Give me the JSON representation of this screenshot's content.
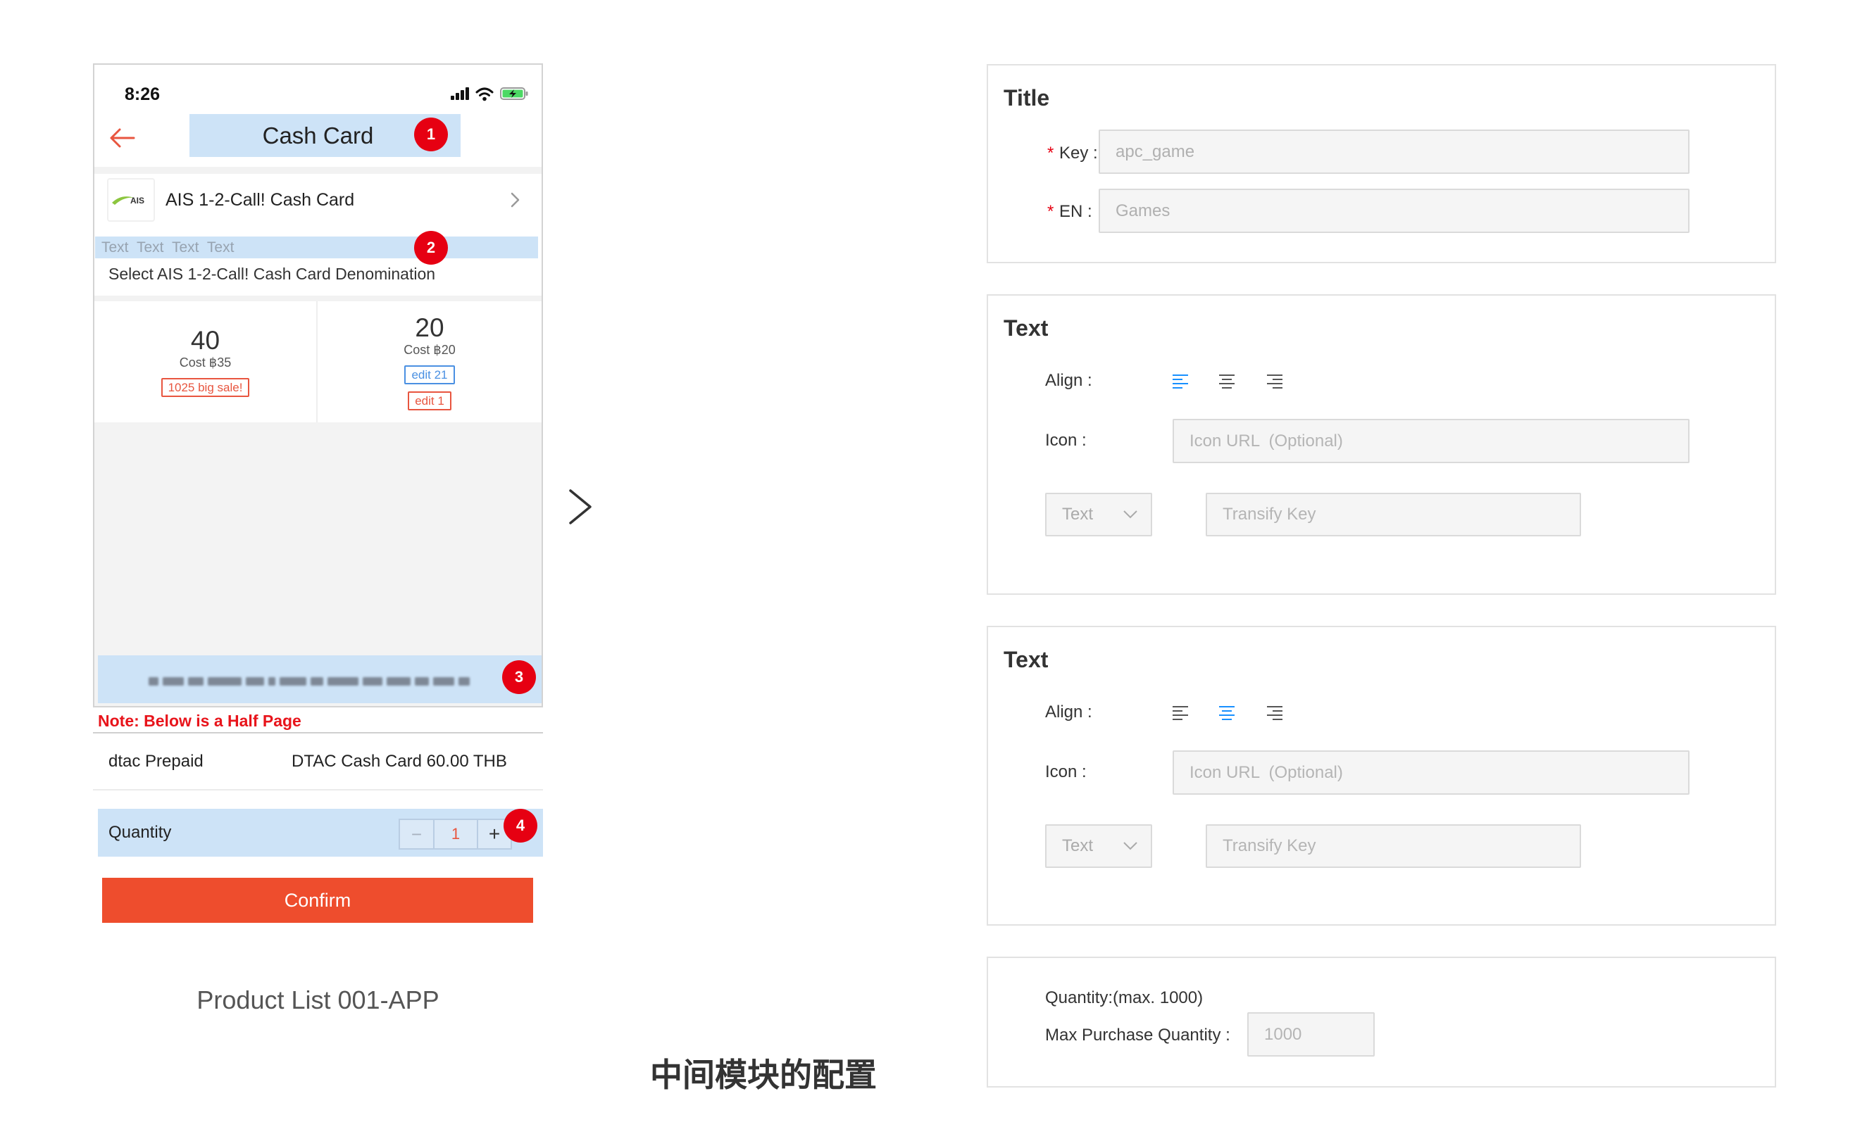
{
  "colors": {
    "badge_red": "#e60012",
    "note_red": "#e8141b",
    "back_arrow": "#e8553f",
    "confirm_orange": "#ee4d2d",
    "highlight_blue": "#cde3f7",
    "active_blue": "#1890ff",
    "tag_red": "#e8553f",
    "tag_blue": "#4a90e2",
    "battery_green": "#4cd964",
    "logo_green": "#8cc63f"
  },
  "phone": {
    "status_bar": {
      "time": "8:26",
      "icons": [
        "signal-icon",
        "wifi-icon",
        "battery-charging-icon"
      ]
    },
    "header": {
      "back_icon": "back-arrow-icon",
      "title": "Cash Card",
      "marker": "1"
    },
    "product": {
      "logo_text": "AIS",
      "name": "AIS 1-2-Call! Cash Card",
      "chevron_icon": "chevron-right-icon"
    },
    "text_strip": {
      "text": "Text Text Text Text",
      "marker": "2"
    },
    "denomination_prompt": "Select AIS 1-2-Call! Cash Card Denomination",
    "denominations": [
      {
        "value": "40",
        "cost": "Cost ฿35",
        "tags": [
          {
            "text": "1025 big sale!",
            "color": "#e8553f"
          }
        ]
      },
      {
        "value": "20",
        "cost": "Cost ฿20",
        "tags": [
          {
            "text": "edit 21",
            "color": "#4a90e2"
          },
          {
            "text": "edit 1",
            "color": "#e8553f"
          }
        ]
      }
    ],
    "blurred_strip": {
      "marker": "3"
    },
    "note": "Note: Below is a Half Page",
    "half_page": {
      "carrier": "dtac Prepaid",
      "product": "DTAC Cash Card 60.00 THB",
      "quantity_label": "Quantity",
      "quantity_minus": "−",
      "quantity_value": "1",
      "quantity_plus": "+",
      "marker": "4",
      "confirm_label": "Confirm"
    },
    "caption": "Product List 001-APP"
  },
  "transition_icon": "chevron-right-icon",
  "section_caption": "中间模块的配置",
  "config": {
    "title_panel": {
      "heading": "Title",
      "key_field": {
        "required_mark": "*",
        "label": "Key :",
        "value": "apc_game"
      },
      "en_field": {
        "required_mark": "*",
        "label": "EN :",
        "value": "Games"
      }
    },
    "text_panels": [
      {
        "heading": "Text",
        "align_label": "Align :",
        "align_options": [
          "align-left-icon",
          "align-center-icon",
          "align-right-icon"
        ],
        "align_active": 0,
        "icon_label": "Icon :",
        "icon_placeholder": "Icon URL  (Optional)",
        "type_select": "Text",
        "key_placeholder": "Transify Key"
      },
      {
        "heading": "Text",
        "align_label": "Align :",
        "align_options": [
          "align-left-icon",
          "align-center-icon",
          "align-right-icon"
        ],
        "align_active": 1,
        "icon_label": "Icon :",
        "icon_placeholder": "Icon URL  (Optional)",
        "type_select": "Text",
        "key_placeholder": "Transify Key"
      }
    ],
    "quantity_panel": {
      "hint": "Quantity:(max. 1000)",
      "label": "Max Purchase Quantity :",
      "placeholder": "1000"
    }
  }
}
